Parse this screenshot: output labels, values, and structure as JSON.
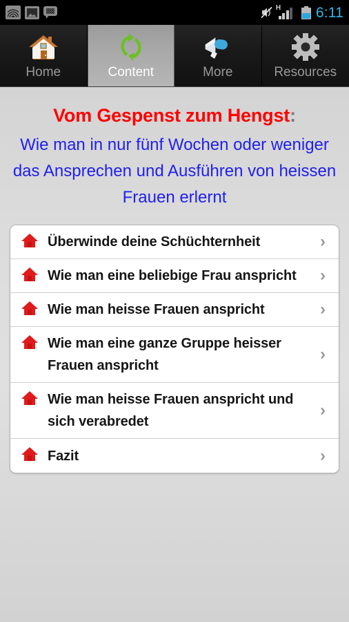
{
  "statusbar": {
    "icons_left": [
      "wifi-icon",
      "gallery-icon",
      "bbm-message-icon"
    ],
    "icons_right": [
      "mute-icon",
      "hsdpa-signal-icon",
      "battery-icon"
    ],
    "signal_label": "H",
    "clock": "6:11"
  },
  "tabs": [
    {
      "label": "Home",
      "icon": "house-icon",
      "active": false
    },
    {
      "label": "Content",
      "icon": "refresh-icon",
      "active": true
    },
    {
      "label": "More",
      "icon": "megaphone-icon",
      "active": false
    },
    {
      "label": "Resources",
      "icon": "gear-icon",
      "active": false
    }
  ],
  "page": {
    "headline": "Vom Gespenst zum Hengst",
    "headline_colon": ":",
    "subheadline": "Wie man in nur fünf Wochen oder weniger das Ansprechen und Ausführen von heissen Frauen erlernt"
  },
  "list": {
    "chevron": "›",
    "items": [
      {
        "label": "Überwinde deine Schüchternheit",
        "icon": "house-icon"
      },
      {
        "label": "Wie man eine beliebige Frau anspricht",
        "icon": "house-icon"
      },
      {
        "label": "Wie man heisse Frauen anspricht",
        "icon": "house-icon"
      },
      {
        "label": "Wie man eine ganze Gruppe heisser Frauen anspricht",
        "icon": "house-icon"
      },
      {
        "label": "Wie man heisse Frauen anspricht und sich verabredet",
        "icon": "house-icon"
      },
      {
        "label": "Fazit",
        "icon": "house-icon"
      }
    ]
  },
  "colors": {
    "headline_red": "#ff0000",
    "subheadline_blue": "#2020ee",
    "active_tab_bg": "#a8a8a8",
    "clock_blue": "#33b5e5",
    "list_icon_red": "#e01b1b"
  }
}
